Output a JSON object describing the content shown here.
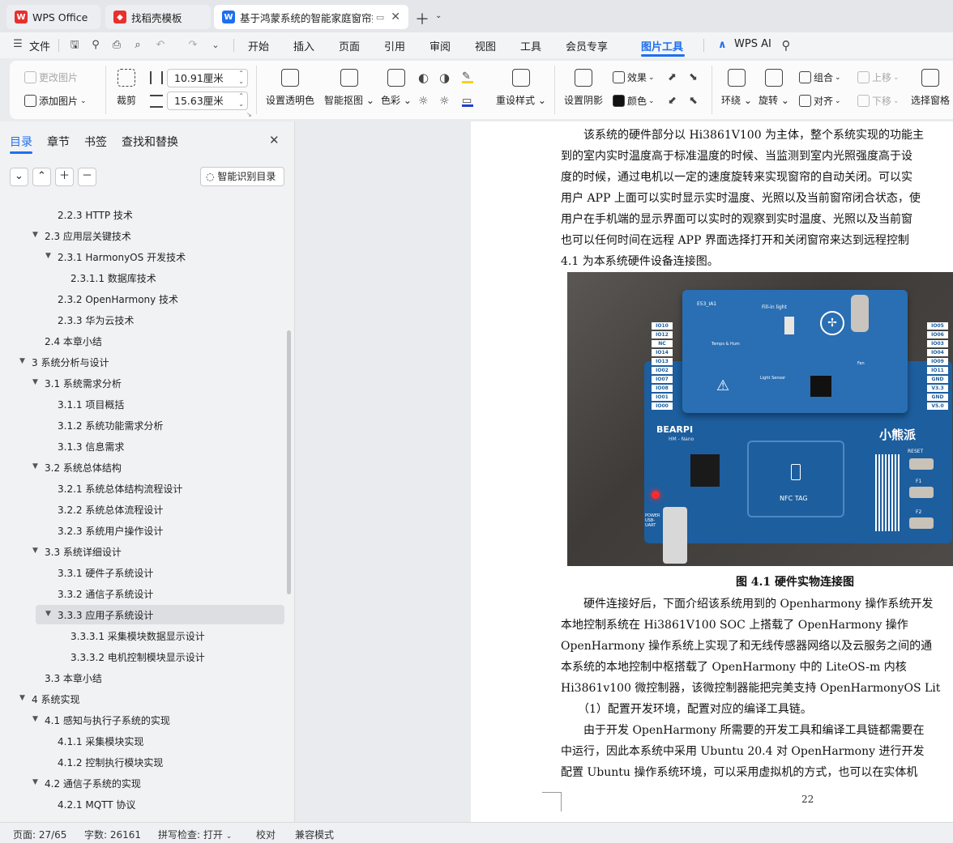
{
  "tabs": {
    "wps": "WPS Office",
    "template": "找稻壳模板",
    "doc": "基于鸿蒙系统的智能家庭窗帘控制系统"
  },
  "menu": {
    "file": "文件",
    "items": [
      "开始",
      "插入",
      "页面",
      "引用",
      "审阅",
      "视图",
      "工具",
      "会员专享",
      "图片工具"
    ],
    "active": "图片工具",
    "ai": "WPS AI"
  },
  "ribbon": {
    "change_image": "更改图片",
    "add_image": "添加图片",
    "crop": "裁剪",
    "width": "10.91厘米",
    "height": "15.63厘米",
    "set_transparent": "设置透明色",
    "smart_cutout": "智能抠图",
    "color": "色彩",
    "preset_style": "重设样式",
    "set_shadow": "设置阴影",
    "effects": "效果",
    "fill_color": "颜色",
    "wrap": "环绕",
    "rotate": "旋转",
    "group": "组合",
    "align": "对齐",
    "bring_forward": "上移",
    "send_backward": "下移",
    "selection_pane": "选择窗格"
  },
  "nav": {
    "tabs": [
      "目录",
      "章节",
      "书签",
      "查找和替换"
    ],
    "smart_toc": "智能识别目录",
    "items": [
      {
        "text": "2.2.3  HTTP 技术",
        "level": 3,
        "arrow": false
      },
      {
        "text": "2.3 应用层关键技术",
        "level": 2,
        "arrow": true
      },
      {
        "text": "2.3.1 HarmonyOS 开发技术",
        "level": 3,
        "arrow": true
      },
      {
        "text": "2.3.1.1 数据库技术",
        "level": 4,
        "arrow": false
      },
      {
        "text": "2.3.2 OpenHarmony 技术",
        "level": 3,
        "arrow": false
      },
      {
        "text": "2.3.3 华为云技术",
        "level": 3,
        "arrow": false
      },
      {
        "text": "2.4 本章小结",
        "level": 2,
        "arrow": false
      },
      {
        "text": "3 系统分析与设计",
        "level": 1,
        "arrow": true
      },
      {
        "text": "3.1 系统需求分析",
        "level": 2,
        "arrow": true
      },
      {
        "text": "3.1.1 项目概括",
        "level": 3,
        "arrow": false
      },
      {
        "text": "3.1.2 系统功能需求分析",
        "level": 3,
        "arrow": false
      },
      {
        "text": "3.1.3 信息需求",
        "level": 3,
        "arrow": false
      },
      {
        "text": "3.2 系统总体结构",
        "level": 2,
        "arrow": true
      },
      {
        "text": "3.2.1 系统总体结构流程设计",
        "level": 3,
        "arrow": false
      },
      {
        "text": "3.2.2 系统总体流程设计",
        "level": 3,
        "arrow": false
      },
      {
        "text": "3.2.3 系统用户操作设计",
        "level": 3,
        "arrow": false
      },
      {
        "text": "3.3 系统详细设计",
        "level": 2,
        "arrow": true
      },
      {
        "text": "3.3.1 硬件子系统设计",
        "level": 3,
        "arrow": false
      },
      {
        "text": "3.3.2 通信子系统设计",
        "level": 3,
        "arrow": false
      },
      {
        "text": "3.3.3 应用子系统设计",
        "level": 3,
        "arrow": true,
        "selected": true
      },
      {
        "text": "3.3.3.1 采集模块数据显示设计",
        "level": 4,
        "arrow": false
      },
      {
        "text": "3.3.3.2 电机控制模块显示设计",
        "level": 4,
        "arrow": false
      },
      {
        "text": "3.3 本章小结",
        "level": 2,
        "arrow": false
      },
      {
        "text": "4  系统实现",
        "level": 1,
        "arrow": true
      },
      {
        "text": "4.1 感知与执行子系统的实现",
        "level": 2,
        "arrow": true
      },
      {
        "text": "4.1.1 采集模块实现",
        "level": 3,
        "arrow": false
      },
      {
        "text": "4.1.2 控制执行模块实现",
        "level": 3,
        "arrow": false
      },
      {
        "text": "4.2 通信子系统的实现",
        "level": 2,
        "arrow": true
      },
      {
        "text": "4.2.1 MQTT 协议",
        "level": 3,
        "arrow": false
      }
    ]
  },
  "doc": {
    "lines": [
      "　　该系统的硬件部分以 Hi3861V100 为主体，整个系统实现的功能主",
      "到的室内实时温度高于标准温度的时候、当监测到室内光照强度高于设",
      "度的时候，通过电机以一定的速度旋转来实现窗帘的自动关闭。可以实",
      "用户 APP 上面可以实时显示实时温度、光照以及当前窗帘闭合状态，使",
      "用户在手机端的显示界面可以实时的观察到实时温度、光照以及当前窗",
      "也可以任何时间在远程 APP 界面选择打开和关闭窗帘来达到远程控制",
      "4.1 为本系统硬件设备连接图。"
    ],
    "caption": "图 4.1  硬件实物连接图",
    "lines2": [
      "　　硬件连接好后，下面介绍该系统用到的 Openharmony 操作系统开发",
      "本地控制系统在  Hi3861V100  SOC  上搭载了  OpenHarmony  操作",
      "OpenHarmony 操作系统上实现了和无线传感器网络以及云服务之间的通",
      "本系统的本地控制中枢搭载了  OpenHarmony  中的  LiteOS-m  内核",
      "Hi3861v100 微控制器，该微控制器能把完美支持 OpenHarmonyOS Lit",
      "　　（1）配置开发环境，配置对应的编译工具链。",
      "　　由于开发 OpenHarmony 所需要的开发工具和编译工具链都需要在",
      "中运行，因此本系统中采用 Ubuntu 20.4 对 OpenHarmony 进行开发",
      "配置 Ubuntu 操作系统环境，可以采用虚拟机的方式，也可以在实体机"
    ],
    "page_number": "22",
    "board": {
      "top_label": "E53_IA1",
      "fill_light": "Fill-in light",
      "temp_hum": "Temps & Hum",
      "light_sensor": "Light Sensor",
      "fan": "Fan",
      "brand": "BEARPI",
      "brand_sub": "HM - Nano",
      "brand_cn": "小熊派",
      "nfc": "NFC TAG",
      "reset": "RESET",
      "f1": "F1",
      "f2": "F2",
      "power": "POWER USB-UART",
      "io_left": [
        "IO10",
        "IO12",
        "NC",
        "IO14",
        "IO13",
        "IO02",
        "IO07",
        "IO08",
        "IO01",
        "IO00"
      ],
      "io_right": [
        "IO05",
        "IO06",
        "IO03",
        "IO04",
        "IO09",
        "IO11",
        "GND",
        "V3.3",
        "GND",
        "V5.0"
      ]
    }
  },
  "status": {
    "page": "页面: 27/65",
    "words": "字数: 26161",
    "spell": "拼写检查: 打开",
    "proof": "校对",
    "compat": "兼容模式"
  },
  "colors": {
    "accent": "#1e6ff0",
    "wps_red": "#e8302c",
    "board_blue": "#1f5fa0"
  }
}
